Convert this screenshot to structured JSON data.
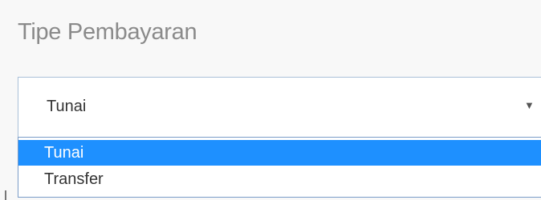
{
  "payment_type": {
    "label": "Tipe Pembayaran",
    "selected_value": "Tunai",
    "arrow_icon": "triangle-down-icon",
    "options": [
      {
        "label": "Tunai",
        "highlighted": true
      },
      {
        "label": "Transfer",
        "highlighted": false
      }
    ],
    "colors": {
      "highlight_bg": "#1e90ff",
      "highlight_text": "#ffffff",
      "border": "#a9c0d8"
    }
  }
}
